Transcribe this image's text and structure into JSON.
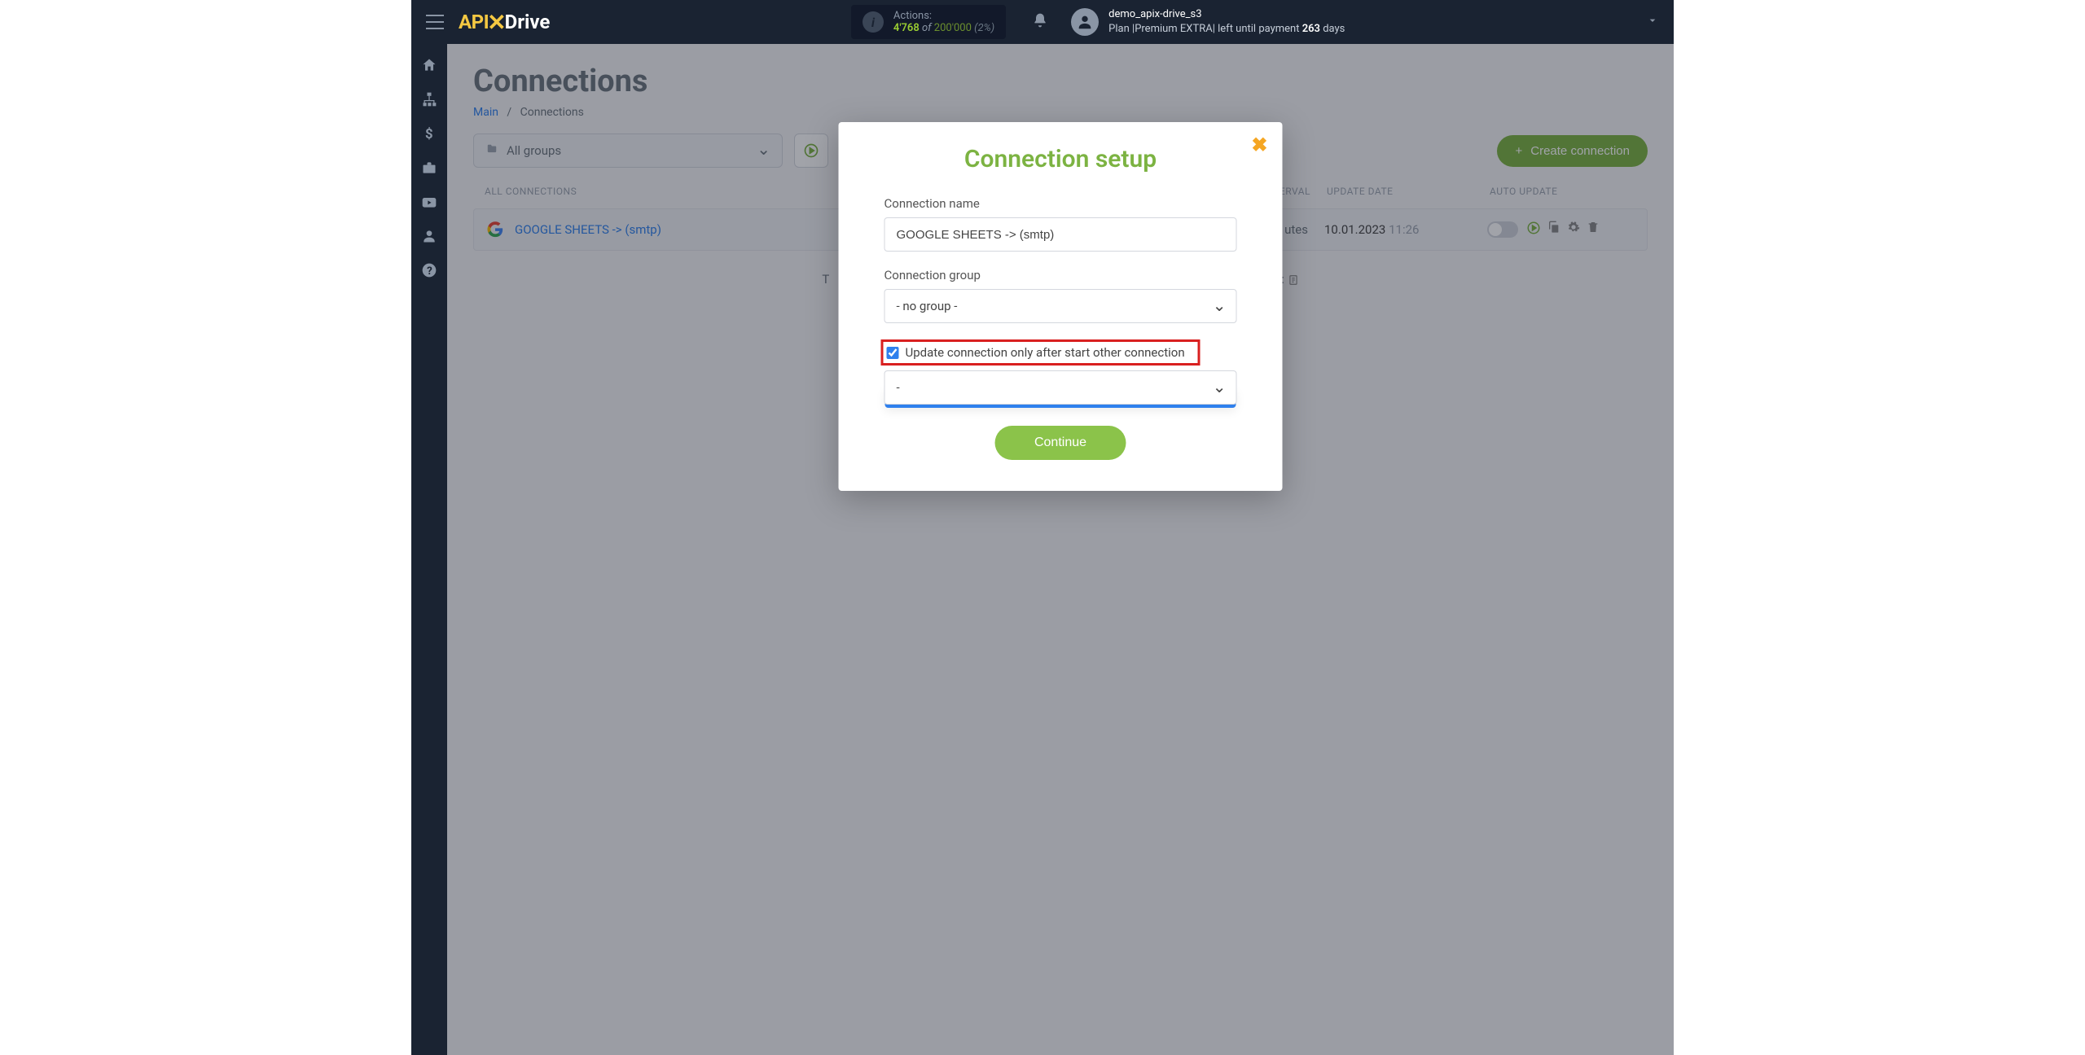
{
  "topbar": {
    "actions_label": "Actions:",
    "actions_count": "4'768",
    "actions_of": "of",
    "actions_total": "200'000",
    "actions_pct": "(2%)",
    "username": "demo_apix-drive_s3",
    "plan_prefix": "Plan |",
    "plan_name": "Premium EXTRA",
    "plan_suffix": "| left until payment",
    "days_num": "263",
    "days_word": "days"
  },
  "page": {
    "title": "Connections",
    "breadcrumb_main": "Main",
    "breadcrumb_sep": "/",
    "breadcrumb_current": "Connections",
    "group_selector": "All groups",
    "create_button": "Create connection",
    "all_conn_header": "ALL CONNECTIONS",
    "col_interval": "TERVAL",
    "col_update": "UPDATE DATE",
    "col_auto": "AUTO UPDATE",
    "below_text_left": "T",
    "below_text_right": "s:"
  },
  "row": {
    "name": "GOOGLE SHEETS -> (smtp)",
    "interval_suffix": "utes",
    "date": "10.01.2023",
    "time": "11:26"
  },
  "modal": {
    "title": "Connection setup",
    "name_label": "Connection name",
    "name_value": "GOOGLE SHEETS -> (smtp)",
    "group_label": "Connection group",
    "group_value": "- no group -",
    "checkbox_label": "Update connection only after start other connection",
    "dep_value": "-",
    "dropdown_option": "-",
    "continue": "Continue"
  }
}
